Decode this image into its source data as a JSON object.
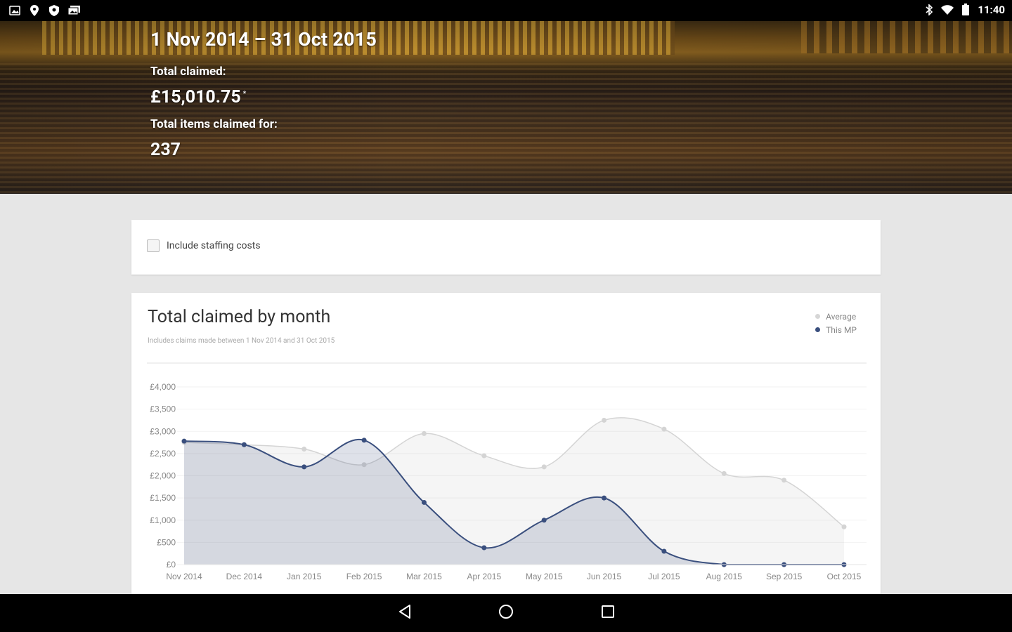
{
  "status_bar": {
    "time": "11:40",
    "left_icons": [
      "gallery-icon",
      "location-icon",
      "shield-icon",
      "photos-icon"
    ],
    "right_icons": [
      "bluetooth-icon",
      "wifi-icon",
      "battery-icon"
    ]
  },
  "header": {
    "period": "1 Nov 2014 – 31 Oct 2015",
    "total_claimed_label": "Total claimed:",
    "total_claimed_value": "£15,010.75",
    "total_claimed_marker": "*",
    "total_items_label": "Total items claimed for:",
    "total_items_value": "237"
  },
  "options": {
    "include_staffing_label": "Include staffing costs",
    "include_staffing_checked": false
  },
  "chart": {
    "title": "Total claimed by month",
    "subtitle": "Includes claims made between 1 Nov 2014 and 31 Oct 2015",
    "legend": [
      {
        "name": "Average",
        "color": "#d6d6d6"
      },
      {
        "name": "This MP",
        "color": "#3a4f7e"
      }
    ]
  },
  "chart_data": {
    "type": "area",
    "title": "Total claimed by month",
    "categories": [
      "Nov 2014",
      "Dec 2014",
      "Jan 2015",
      "Feb 2015",
      "Mar 2015",
      "Apr 2015",
      "May 2015",
      "Jun 2015",
      "Jul 2015",
      "Aug 2015",
      "Sep 2015",
      "Oct 2015"
    ],
    "series": [
      {
        "name": "Average",
        "color": "#d6d6d6",
        "values": [
          2750,
          2700,
          2600,
          2250,
          2950,
          2450,
          2200,
          3250,
          3050,
          2050,
          1900,
          850
        ]
      },
      {
        "name": "This MP",
        "color": "#3a4f7e",
        "values": [
          2780,
          2700,
          2200,
          2800,
          1400,
          380,
          1000,
          1500,
          300,
          0,
          0,
          0
        ]
      }
    ],
    "ylim": [
      0,
      4000
    ],
    "yticks": [
      "£0",
      "£500",
      "£1,000",
      "£1,500",
      "£2,000",
      "£2,500",
      "£3,000",
      "£3,500",
      "£4,000"
    ],
    "ytick_values": [
      0,
      500,
      1000,
      1500,
      2000,
      2500,
      3000,
      3500,
      4000
    ],
    "grid": true,
    "legend_position": "top-right"
  },
  "nav_bar": {
    "buttons": [
      "back-icon",
      "home-icon",
      "recents-icon"
    ]
  }
}
